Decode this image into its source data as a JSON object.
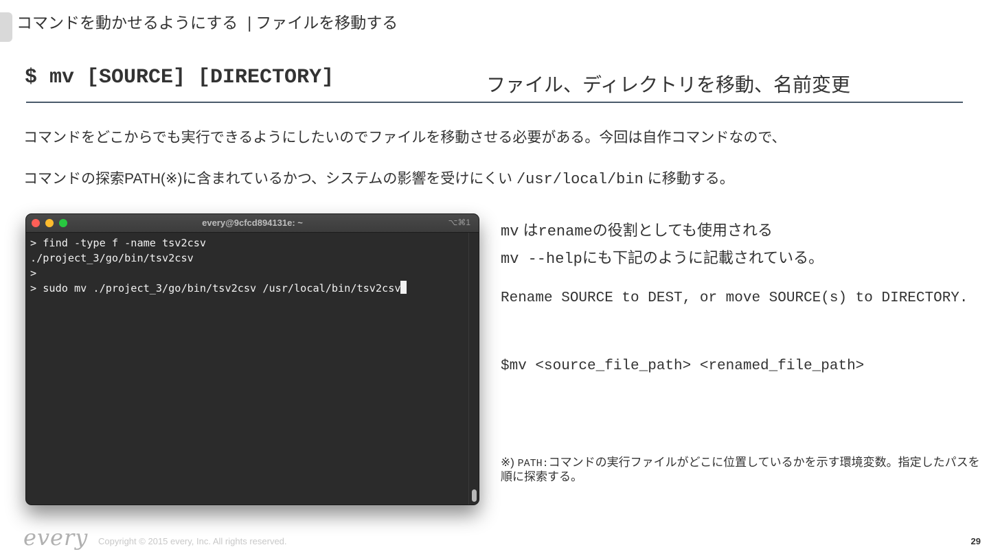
{
  "breadcrumb": {
    "section": "コマンドを動かせるようにする",
    "separator": "|",
    "page": "ファイルを移動する"
  },
  "heading": {
    "command": "$ mv [SOURCE] [DIRECTORY]",
    "description": "ファイル、ディレクトリを移動、名前変更"
  },
  "body": {
    "line1": "コマンドをどこからでも実行できるようにしたいのでファイルを移動させる必要がある。今回は自作コマンドなので、",
    "line2_before": "コマンドの探索PATH(※)に含まれているかつ、システムの影響を受けにくい",
    "line2_path": "/usr/local/bin",
    "line2_after": "に移動する。"
  },
  "terminal": {
    "title": "every@9cfcd894131e: ~",
    "shortcut": "⌥⌘1",
    "lines": [
      "> find -type f -name tsv2csv",
      "./project_3/go/bin/tsv2csv",
      ">",
      "> sudo mv ./project_3/go/bin/tsv2csv /usr/local/bin/tsv2csv"
    ]
  },
  "notes": {
    "line1_cmd": "mv",
    "line1_a": " は",
    "line1_rename": "rename",
    "line1_b": "の役割としても使用される",
    "line2_cmd": "mv --help",
    "line2_text": "にも下記のように記載されている。",
    "help_text": "Rename SOURCE to DEST, or move SOURCE(s) to DIRECTORY.",
    "usage": "$mv <source_file_path> <renamed_file_path>"
  },
  "footnote": {
    "mark": "※)",
    "term": "PATH:",
    "text": "コマンドの実行ファイルがどこに位置しているかを示す環境変数。指定したパスを順に探索する。"
  },
  "footer": {
    "logo": "every",
    "copyright": "Copyright © 2015 every, Inc. All rights reserved.",
    "page_number": "29"
  }
}
